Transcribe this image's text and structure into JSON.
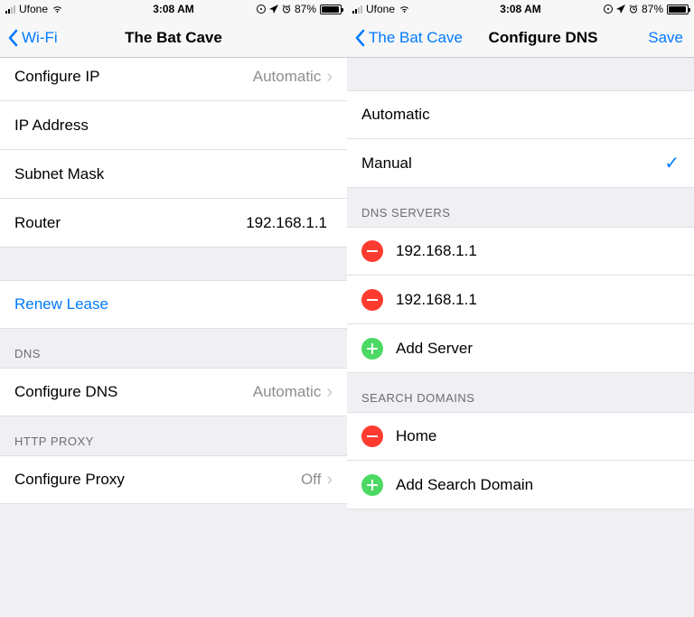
{
  "statusbar": {
    "carrier": "Ufone",
    "time": "3:08 AM",
    "battery_pct": "87%"
  },
  "left": {
    "nav_back": "Wi-Fi",
    "nav_title": "The Bat Cave",
    "rows": {
      "configure_ip_label": "Configure IP",
      "configure_ip_value": "Automatic",
      "ip_address_label": "IP Address",
      "subnet_mask_label": "Subnet Mask",
      "router_label": "Router",
      "router_value": "192.168.1.1",
      "renew_lease": "Renew Lease"
    },
    "sections": {
      "dns": "DNS",
      "http_proxy": "HTTP PROXY"
    },
    "dns_row": {
      "label": "Configure DNS",
      "value": "Automatic"
    },
    "proxy_row": {
      "label": "Configure Proxy",
      "value": "Off"
    }
  },
  "right": {
    "nav_back": "The Bat Cave",
    "nav_title": "Configure DNS",
    "nav_save": "Save",
    "options": {
      "automatic": "Automatic",
      "manual": "Manual"
    },
    "sections": {
      "dns_servers": "DNS SERVERS",
      "search_domains": "SEARCH DOMAINS"
    },
    "dns_servers": [
      "192.168.1.1",
      "192.168.1.1"
    ],
    "add_server": "Add Server",
    "search_domains": [
      "Home"
    ],
    "add_search_domain": "Add Search Domain"
  }
}
